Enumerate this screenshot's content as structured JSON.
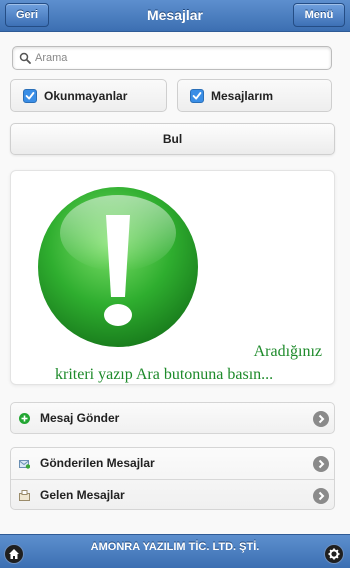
{
  "header": {
    "title": "Mesajlar",
    "back_label": "Geri",
    "menu_label": "Menü"
  },
  "search": {
    "placeholder": "Arama",
    "value": ""
  },
  "filters": {
    "unread_label": "Okunmayanlar",
    "unread_checked": true,
    "mine_label": "Mesajlarım",
    "mine_checked": true
  },
  "find_label": "Bul",
  "info": {
    "icon": "exclamation-icon",
    "line1": "Aradığınız",
    "line2": "kriteri yazıp Ara butonuna basın..."
  },
  "actions": {
    "send": {
      "label": "Mesaj Gönder",
      "icon": "plus-circle-icon"
    },
    "sent": {
      "label": "Gönderilen Mesajlar",
      "icon": "outbox-icon"
    },
    "inbox": {
      "label": "Gelen Mesajlar",
      "icon": "inbox-icon"
    }
  },
  "footer": {
    "company": "AMONRA YAZILIM TİC. LTD. ŞTİ."
  },
  "colors": {
    "header": "#4a7fc1",
    "accent_green": "#1d8a2a",
    "checkbox": "#3a8ee6"
  }
}
